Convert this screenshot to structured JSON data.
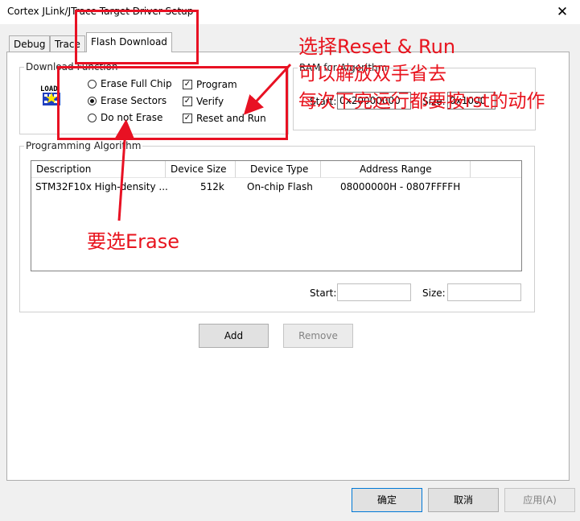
{
  "window": {
    "title": "Cortex JLink/JTrace Target Driver Setup",
    "close_glyph": "✕"
  },
  "tabs": [
    {
      "label": "Debug"
    },
    {
      "label": "Trace"
    },
    {
      "label": "Flash Download"
    }
  ],
  "download_function": {
    "title": "Download Function",
    "icon_text": "LOAD",
    "erase_options": [
      {
        "label": "Erase Full Chip",
        "selected": false
      },
      {
        "label": "Erase Sectors",
        "selected": true
      },
      {
        "label": "Do not Erase",
        "selected": false
      }
    ],
    "checks": [
      {
        "label": "Program",
        "checked": true
      },
      {
        "label": "Verify",
        "checked": true
      },
      {
        "label": "Reset and Run",
        "checked": true
      }
    ],
    "check_glyph": "✓"
  },
  "ram": {
    "title": "RAM for Algorithm",
    "start_label": "Start:",
    "start_value": "0x20000000",
    "size_label": "Size:",
    "size_value": "0x1000"
  },
  "programming_algorithm": {
    "title": "Programming Algorithm",
    "columns": [
      "Description",
      "Device Size",
      "Device Type",
      "Address Range"
    ],
    "rows": [
      {
        "description": "STM32F10x High-density ...",
        "size": "512k",
        "type": "On-chip Flash",
        "range": "08000000H - 0807FFFFH"
      }
    ],
    "start_label": "Start:",
    "start_value": "",
    "size_label": "Size:",
    "size_value": ""
  },
  "buttons": {
    "add": "Add",
    "remove": "Remove",
    "ok": "确定",
    "cancel": "取消",
    "apply": "应用(A)"
  },
  "annotations": {
    "select_reset_run": "选择Reset & Run",
    "line2": "可以解放双手省去",
    "line3": "每次下完运行都要按rst的动作",
    "choose_erase": "要选Erase"
  },
  "colors": {
    "annotation_red": "#e81123",
    "default_button_border": "#0078d7"
  }
}
